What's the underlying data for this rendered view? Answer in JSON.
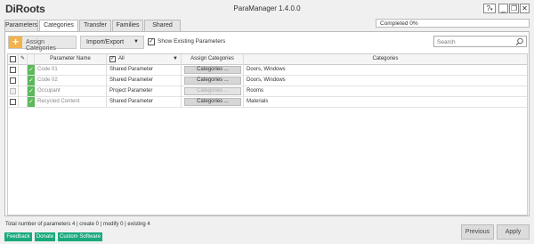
{
  "app": {
    "logo": "DiRoots",
    "title": "ParaManager 1.4.0.0"
  },
  "window_buttons": {
    "help": "?",
    "help_caret": "▾",
    "minimize": "_",
    "restore": "❐",
    "close": "✕"
  },
  "tabs": [
    {
      "label": "Parameters",
      "active": false
    },
    {
      "label": "Categories",
      "active": true
    },
    {
      "label": "Transfer",
      "active": false
    },
    {
      "label": "Families",
      "active": false
    },
    {
      "label": "Shared Editor",
      "active": false
    }
  ],
  "progress": {
    "text": "Completed 0%",
    "value_percent": 0
  },
  "toolbar": {
    "assign_label": "Assign Categories",
    "import_export_label": "Import/Export",
    "show_existing_label": "Show Existing Parameters",
    "show_existing_checked": true,
    "search_placeholder": "Search"
  },
  "grid": {
    "headers": {
      "parameter_name": "Parameter Name",
      "all_filter": "All",
      "assign_categories": "Assign Categories",
      "categories": "Categories"
    },
    "rows": [
      {
        "name": "Code 01",
        "type": "Shared Parameter",
        "button": "Categories ...",
        "button_enabled": true,
        "categories": "Doors, Windows"
      },
      {
        "name": "Code 02",
        "type": "Shared Parameter",
        "button": "Categories ...",
        "button_enabled": true,
        "categories": "Doors, Windows"
      },
      {
        "name": "Occupant",
        "type": "Project Parameter",
        "button": "Categories ...",
        "button_enabled": false,
        "categories": "Rooms"
      },
      {
        "name": "Recycled Content",
        "type": "Shared Parameter",
        "button": "Categories ...",
        "button_enabled": true,
        "categories": "Materials"
      }
    ]
  },
  "footer": {
    "status": "Total number of parameters 4 | create 0 | modify 0 | existing 4",
    "feedback": "Feedback",
    "donate": "Donate",
    "custom_software": "Custom Software",
    "previous": "Previous",
    "apply": "Apply"
  },
  "colors": {
    "accent_orange": "#f3b24a",
    "status_green": "#5cb85c",
    "link_green": "#19a97d"
  }
}
